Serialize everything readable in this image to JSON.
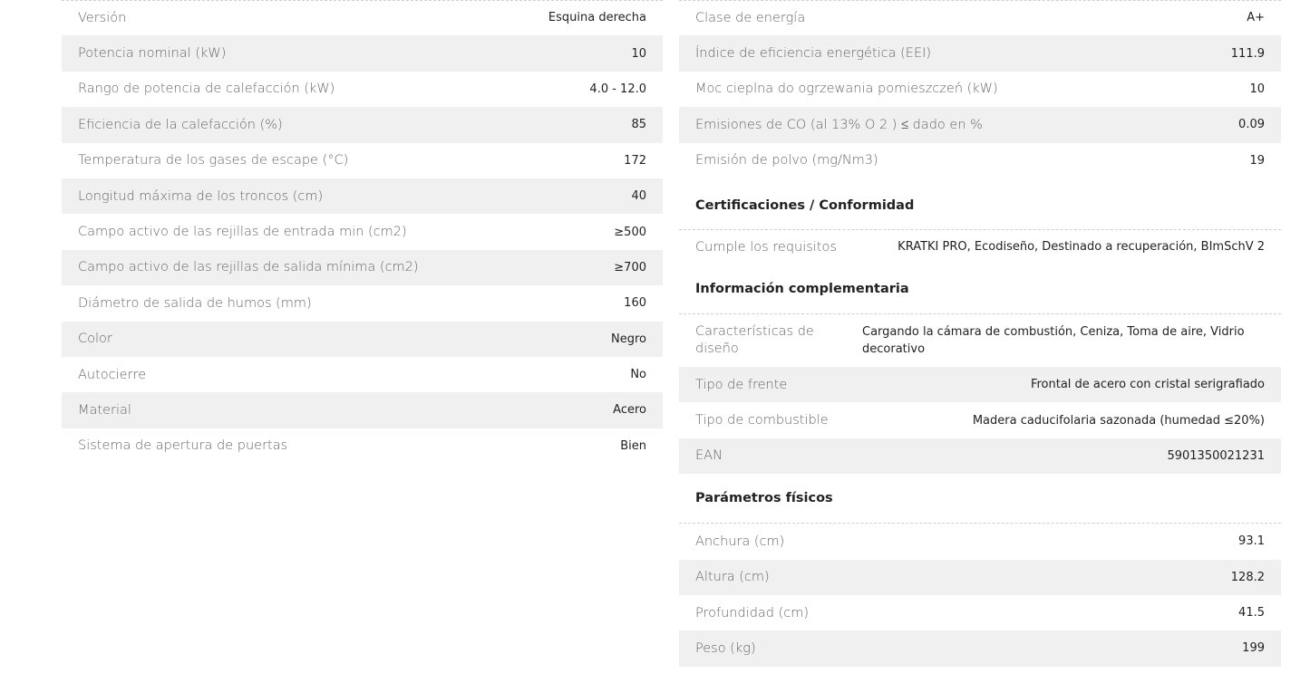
{
  "left": [
    {
      "label": "Versión",
      "value": "Esquina derecha"
    },
    {
      "label": "Potencia nominal (kW)",
      "value": "10"
    },
    {
      "label": "Rango de potencia de calefacción (kW)",
      "value": "4.0 - 12.0"
    },
    {
      "label": "Eficiencia de la calefacción (%)",
      "value": "85"
    },
    {
      "label": "Temperatura de los gases de escape (°C)",
      "value": "172"
    },
    {
      "label": "Longitud máxima de los troncos (cm)",
      "value": "40"
    },
    {
      "label": "Campo activo de las rejillas de entrada min (cm2)",
      "value": "≥500"
    },
    {
      "label": "Campo activo de las rejillas de salida mínima (cm2)",
      "value": "≥700"
    },
    {
      "label": "Diámetro de salida de humos (mm)",
      "value": "160"
    },
    {
      "label": "Color",
      "value": "Negro"
    },
    {
      "label": "Autocierre",
      "value": "No"
    },
    {
      "label": "Material",
      "value": "Acero"
    },
    {
      "label": "Sistema de apertura de puertas",
      "value": "Bien"
    }
  ],
  "right_energy": [
    {
      "label": "Clase de energía",
      "value": "A+"
    },
    {
      "label": "Índice de eficiencia energética (EEI)",
      "value": "111.9"
    },
    {
      "label": "Moc cieplna do ogrzewania pomieszczeń (kW)",
      "value": "10"
    },
    {
      "label": "Emisiones de CO (al 13% O 2 ) ≤ dado en %",
      "value": "0.09"
    },
    {
      "label": "Emisión de polvo (mg/Nm3)",
      "value": "19"
    }
  ],
  "certifications": {
    "title": "Certificaciones / Conformidad",
    "rows": [
      {
        "label": "Cumple los requisitos",
        "value": "KRATKI PRO, Ecodiseño, Destinado a recuperación, BImSchV 2"
      }
    ]
  },
  "complementary": {
    "title": "Información complementaria",
    "rows": [
      {
        "label": "Características de diseño",
        "value": "Cargando la cámara de combustión, Ceniza, Toma de aire, Vidrio decorativo"
      },
      {
        "label": "Tipo de frente",
        "value": "Frontal de acero con cristal serigrafiado"
      },
      {
        "label": "Tipo de combustible",
        "value": "Madera caducifolaria sazonada (humedad ≤20%)"
      },
      {
        "label": "EAN",
        "value": "5901350021231"
      }
    ]
  },
  "physical": {
    "title": "Parámetros físicos",
    "rows": [
      {
        "label": "Anchura (cm)",
        "value": "93.1"
      },
      {
        "label": "Altura (cm)",
        "value": "128.2"
      },
      {
        "label": "Profundidad (cm)",
        "value": "41.5"
      },
      {
        "label": "Peso (kg)",
        "value": "199"
      }
    ]
  }
}
